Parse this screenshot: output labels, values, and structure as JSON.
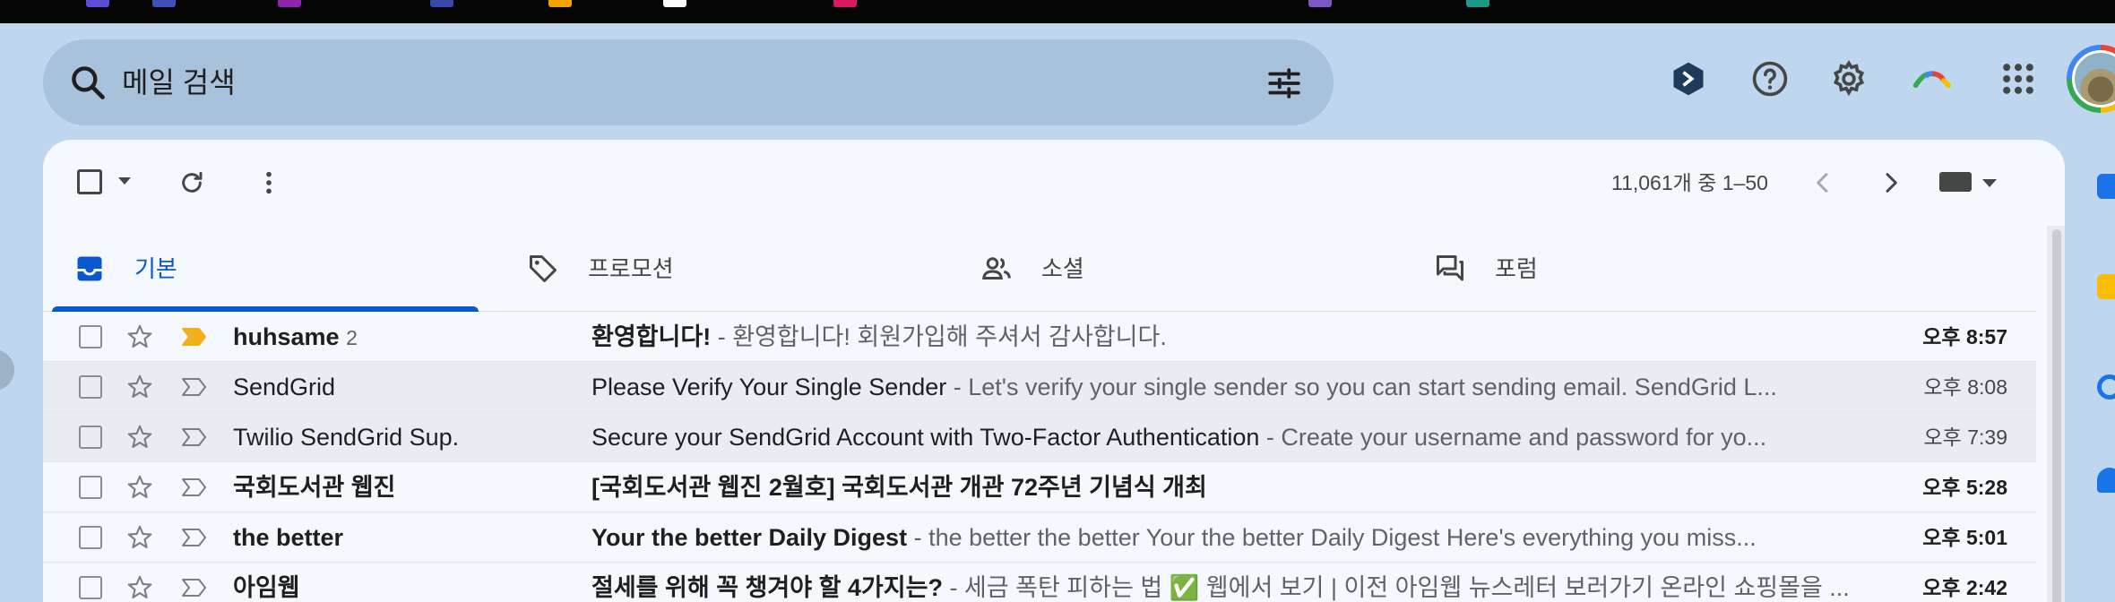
{
  "search": {
    "placeholder": "메일 검색"
  },
  "toolbar": {
    "count_label": "11,061개 중 1–50"
  },
  "tabs": [
    {
      "label": "기본",
      "icon": "inbox-icon",
      "active": true
    },
    {
      "label": "프로모션",
      "icon": "tag-icon",
      "active": false
    },
    {
      "label": "소셜",
      "icon": "people-icon",
      "active": false
    },
    {
      "label": "포럼",
      "icon": "forum-icon",
      "active": false
    }
  ],
  "emails": [
    {
      "sender": "huhsame",
      "count": "2",
      "subject": "환영합니다!",
      "snippet": " - 환영합니다! 회원가입해 주셔서 감사합니다.",
      "time": "오후 8:57",
      "unread": true,
      "important": true
    },
    {
      "sender": "SendGrid",
      "count": "",
      "subject": "Please Verify Your Single Sender",
      "snippet": " - Let's verify your single sender so you can start sending email. SendGrid L...",
      "time": "오후 8:08",
      "unread": false,
      "important": false
    },
    {
      "sender": "Twilio SendGrid Sup.",
      "count": "",
      "subject": "Secure your SendGrid Account with Two-Factor Authentication",
      "snippet": " - Create your username and password for yo...",
      "time": "오후 7:39",
      "unread": false,
      "important": false
    },
    {
      "sender": "국회도서관 웹진",
      "count": "",
      "subject": "[국회도서관 웹진 2월호] 국회도서관 개관 72주년 기념식 개최",
      "snippet": "",
      "time": "오후 5:28",
      "unread": true,
      "important": false
    },
    {
      "sender": "the better",
      "count": "",
      "subject": "Your the better Daily Digest",
      "snippet": " - the better the better Your the better Daily Digest Here's everything you miss...",
      "time": "오후 5:01",
      "unread": true,
      "important": false
    },
    {
      "sender": "아임웹",
      "count": "",
      "subject": "절세를 위해 꼭 챙겨야 할 4가지는?",
      "snippet": " - 세금 폭탄 피하는 법 ✅ 웹에서 보기 | 이전 아임웹 뉴스레터 보러가기 온라인 쇼핑몰을 ...",
      "time": "오후 2:42",
      "unread": true,
      "important": false
    }
  ],
  "colors": {
    "accent": "#0b57d0",
    "background": "#bed7ee",
    "panel": "#f5f8fd",
    "important": "#f2b01e"
  }
}
